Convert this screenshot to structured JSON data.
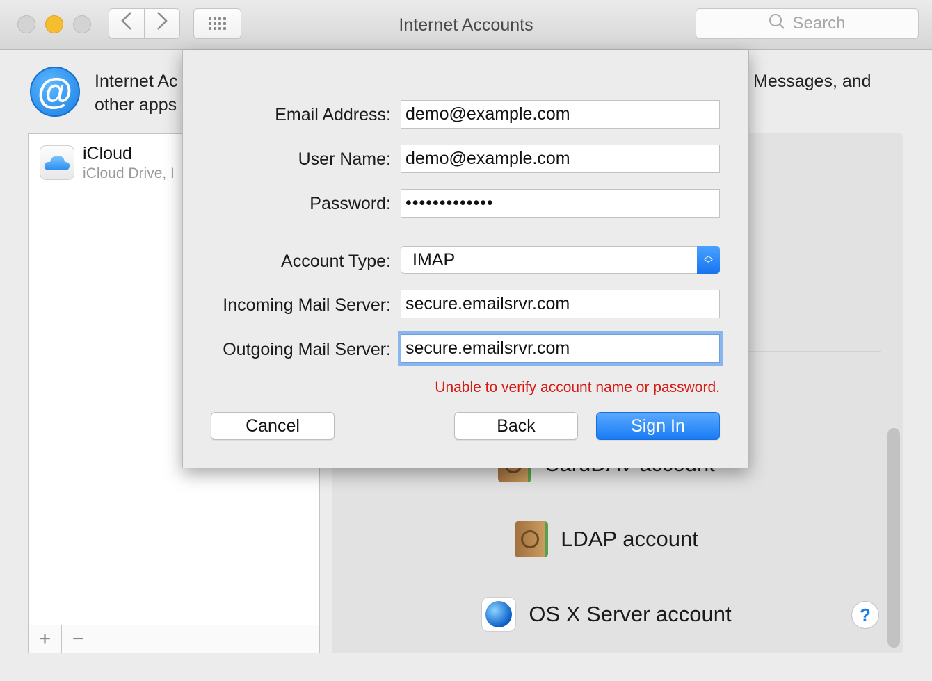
{
  "window": {
    "title": "Internet Accounts",
    "search_placeholder": "Search"
  },
  "header": {
    "line1_left": "Internet Ac",
    "line2_left": "other apps",
    "line1_right": "Messages, and"
  },
  "accounts": [
    {
      "name": "iCloud",
      "subtitle": "iCloud Drive, I"
    }
  ],
  "list_footer": {
    "add": "+",
    "remove": "−"
  },
  "providers": [
    {
      "label": "CardDAV account",
      "icon": "contacts-book-icon"
    },
    {
      "label": "LDAP account",
      "icon": "contacts-book-icon"
    },
    {
      "label": "OS X Server account",
      "icon": "globe-icon"
    }
  ],
  "sheet": {
    "email_label": "Email Address:",
    "email_value": "demo@example.com",
    "username_label": "User Name:",
    "username_value": "demo@example.com",
    "password_label": "Password:",
    "password_value": "•••••••••••••",
    "account_type_label": "Account Type:",
    "account_type_value": "IMAP",
    "incoming_label": "Incoming Mail Server:",
    "incoming_value": "secure.emailsrvr.com",
    "outgoing_label": "Outgoing Mail Server:",
    "outgoing_value": "secure.emailsrvr.com",
    "error": "Unable to verify account name or password.",
    "cancel": "Cancel",
    "back": "Back",
    "sign_in": "Sign In"
  },
  "colors": {
    "accent": "#197cf5",
    "error": "#d51b14",
    "minimize": "#f6be2e"
  },
  "help": "?"
}
